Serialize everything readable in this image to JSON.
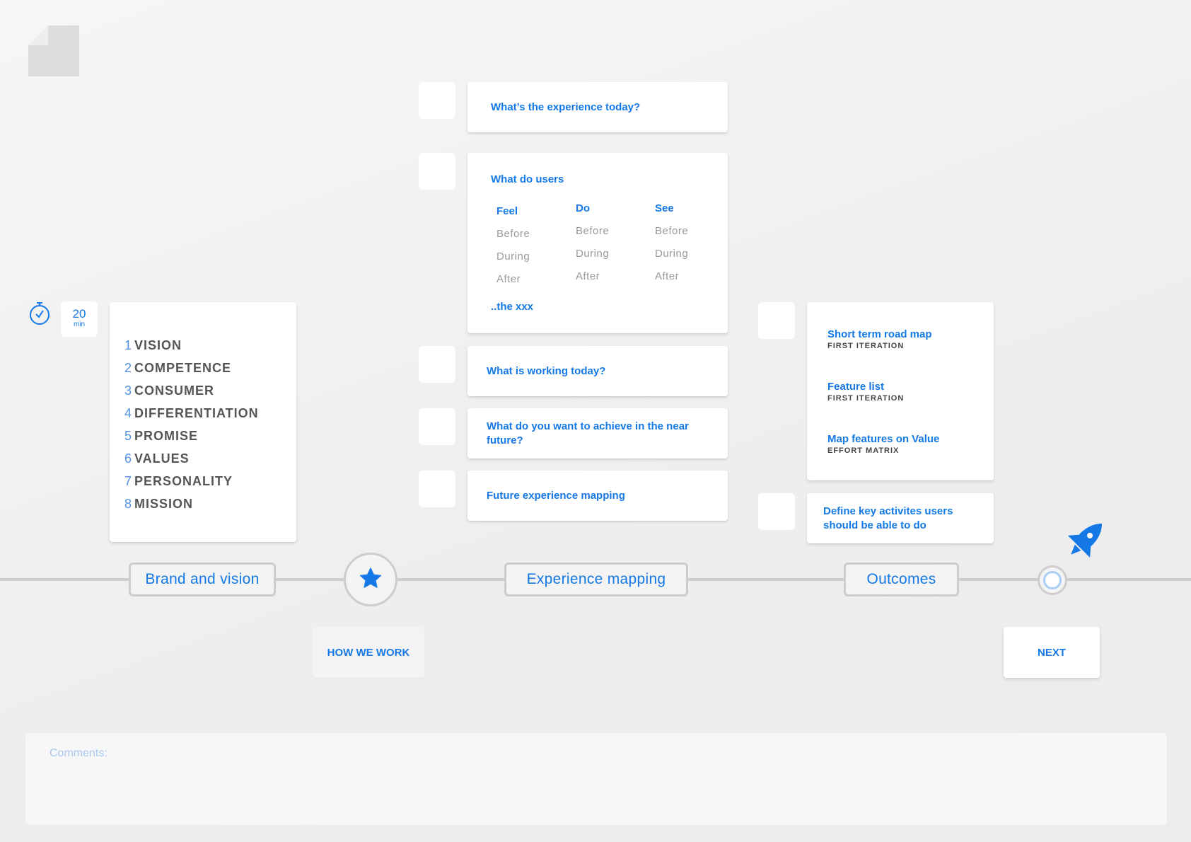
{
  "icons": {
    "doc": "document-icon",
    "timer": "stopwatch-icon",
    "star": "star-icon",
    "rocket": "rocket-icon"
  },
  "colors": {
    "accent": "#1479e6",
    "line": "#cdcdcd",
    "muted_text": "#9a9a9a",
    "dark_text": "#555555"
  },
  "timer": {
    "value": "20",
    "unit": "min"
  },
  "brand_steps": [
    {
      "num": "1",
      "label": "VISION"
    },
    {
      "num": "2",
      "label": "COMPETENCE"
    },
    {
      "num": "3",
      "label": "CONSUMER"
    },
    {
      "num": "4",
      "label": "DIFFERENTIATION"
    },
    {
      "num": "5",
      "label": "PROMISE"
    },
    {
      "num": "6",
      "label": "VALUES"
    },
    {
      "num": "7",
      "label": "PERSONALITY"
    },
    {
      "num": "8",
      "label": "MISSION"
    }
  ],
  "experience": {
    "q1": "What’s the experience today?",
    "users": {
      "title": "What do users",
      "columns": [
        {
          "head": "Feel",
          "items": [
            "Before",
            "During",
            "After"
          ]
        },
        {
          "head": "Do",
          "items": [
            "Before",
            "During",
            "After"
          ]
        },
        {
          "head": "See",
          "items": [
            "Before",
            "During",
            "After"
          ]
        }
      ],
      "footer": "..the xxx"
    },
    "q2": "What is working today?",
    "q3": "What do you want to achieve in the near future?",
    "q4": "Future experience mapping"
  },
  "outcomes": {
    "items": [
      {
        "title": "Short term road map",
        "sub": "FIRST ITERATION"
      },
      {
        "title": "Feature list",
        "sub": "FIRST ITERATION"
      },
      {
        "title": "Map features on Value",
        "sub": "EFFORT MATRIX"
      }
    ],
    "key_activities": "Define key activites users should be able to do"
  },
  "timeline": {
    "brand": "Brand and vision",
    "experience": "Experience mapping",
    "outcomes": "Outcomes"
  },
  "buttons": {
    "how": "HOW WE WORK",
    "next": "NEXT"
  },
  "comments": {
    "label": "Comments:"
  }
}
